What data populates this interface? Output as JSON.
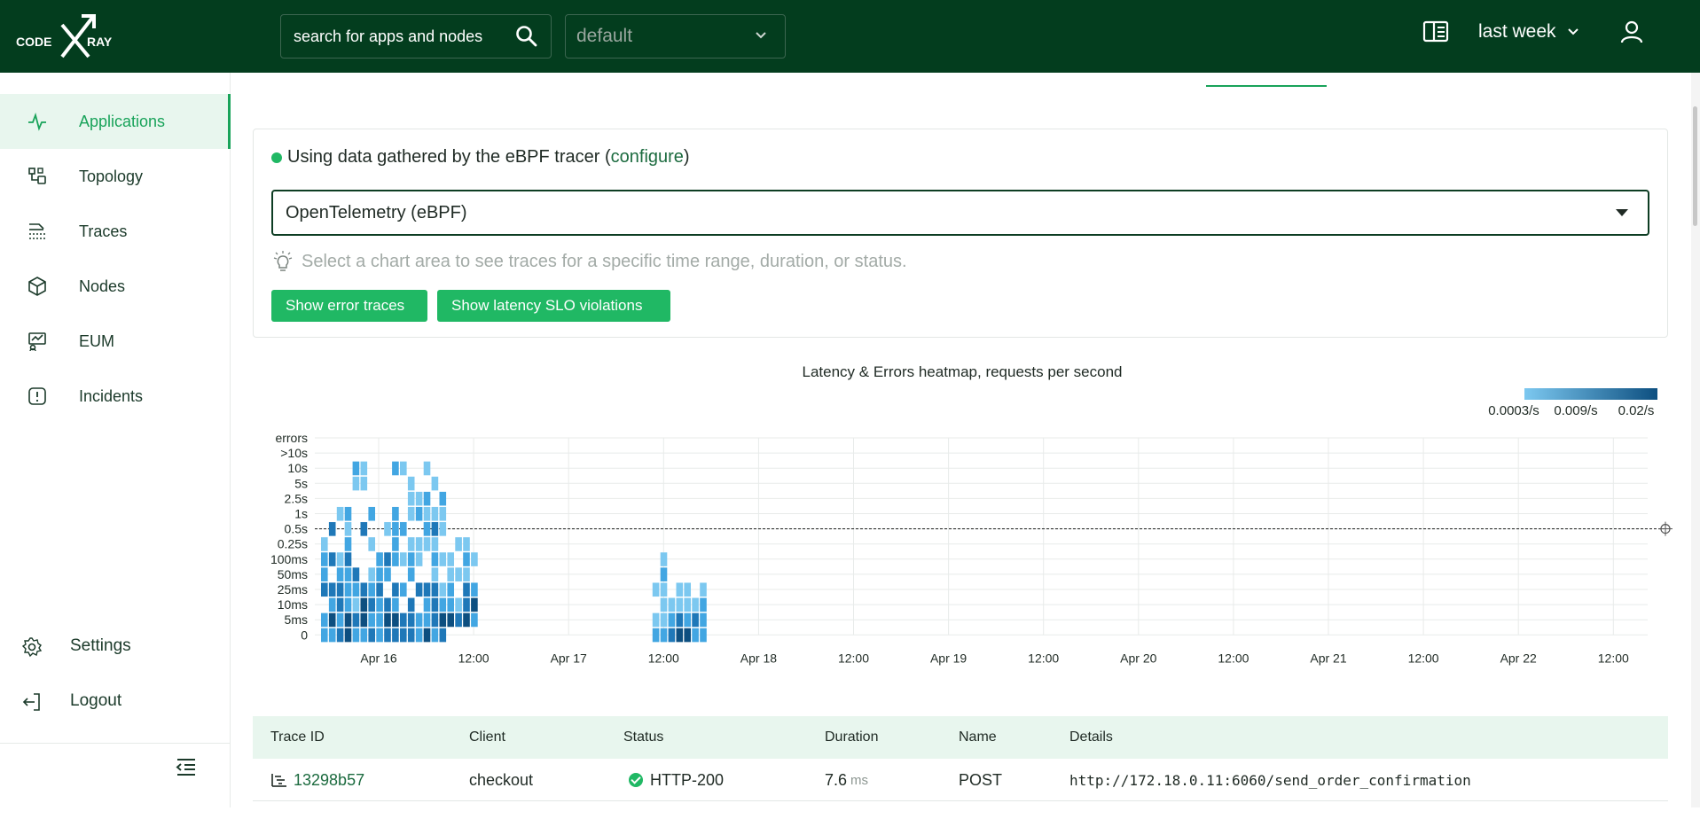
{
  "header": {
    "logo_text": "CODE X RAY",
    "search_placeholder": "search for apps and nodes",
    "project": "default",
    "time_range": "last week"
  },
  "sidebar": {
    "items": [
      {
        "label": "Applications",
        "icon": "pulse-icon",
        "active": true
      },
      {
        "label": "Topology",
        "icon": "topology-icon"
      },
      {
        "label": "Traces",
        "icon": "traces-icon"
      },
      {
        "label": "Nodes",
        "icon": "cube-icon"
      },
      {
        "label": "EUM",
        "icon": "eum-icon"
      },
      {
        "label": "Incidents",
        "icon": "alert-icon"
      }
    ],
    "bottom": [
      {
        "label": "Settings",
        "icon": "gear-icon"
      },
      {
        "label": "Logout",
        "icon": "logout-icon"
      }
    ]
  },
  "tracing": {
    "info_prefix": "Using data gathered by the eBPF tracer (",
    "configure_link": "configure",
    "info_suffix": ")",
    "source": "OpenTelemetry (eBPF)",
    "hint": "Select a chart area to see traces for a specific time range, duration, or status.",
    "btn_errors": "Show error traces",
    "btn_slo": "Show latency SLO violations"
  },
  "chart_data": {
    "type": "heatmap",
    "title": "Latency & Errors heatmap, requests per second",
    "legend": [
      "0.0003/s",
      "0.009/s",
      "0.02/s"
    ],
    "y_labels": [
      "errors",
      ">10s",
      "10s",
      "5s",
      "2.5s",
      "1s",
      "0.5s",
      "0.25s",
      "100ms",
      "50ms",
      "25ms",
      "10ms",
      "5ms",
      "0"
    ],
    "x_labels": [
      "Apr 16",
      "12:00",
      "Apr 17",
      "12:00",
      "Apr 18",
      "12:00",
      "Apr 19",
      "12:00",
      "Apr 20",
      "12:00",
      "Apr 21",
      "12:00",
      "Apr 22",
      "12:00"
    ],
    "colors": [
      "#7cc8f0",
      "#42a6e2",
      "#1f78b8",
      "#0d4f80"
    ],
    "slo_threshold": "0.5s",
    "clusters": [
      {
        "from": "Apr 15 16:00",
        "to": "Apr 16 11:00",
        "min_latency": "0",
        "max_latency": "10s"
      },
      {
        "from": "Apr 16 11:00",
        "to": "Apr 16 15:00",
        "min_latency": "5ms",
        "max_latency": "10s"
      },
      {
        "from": "Apr 17 12:00",
        "to": "Apr 17 21:00",
        "min_latency": "0",
        "max_latency": "100ms"
      }
    ]
  },
  "table": {
    "headers": [
      "Trace ID",
      "Client",
      "Status",
      "Duration",
      "Name",
      "Details"
    ],
    "rows": [
      {
        "trace_id": "13298b57",
        "client": "checkout",
        "status": "HTTP-200",
        "duration": "7.6",
        "unit": "ms",
        "name": "POST",
        "details": "http://172.18.0.11:6060/send_order_confirmation"
      }
    ]
  }
}
